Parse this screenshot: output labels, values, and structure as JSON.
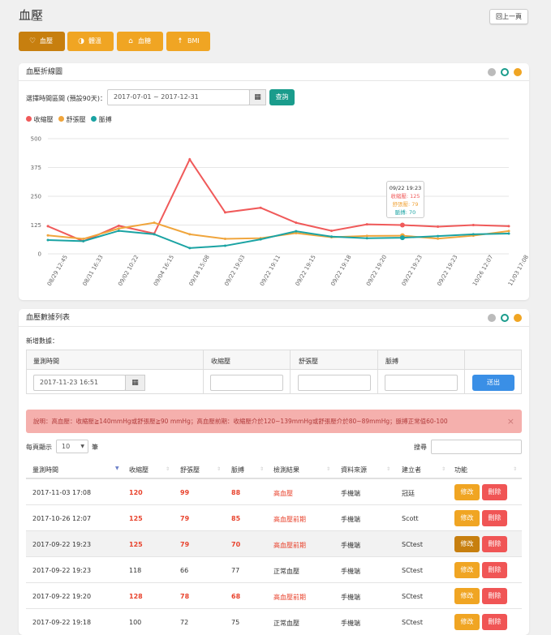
{
  "page": {
    "title": "血壓",
    "back_label": "回上一頁"
  },
  "tabs": [
    {
      "label": "血壓",
      "icon": "heart-icon"
    },
    {
      "label": "體溫",
      "icon": "thermometer-icon"
    },
    {
      "label": "血糖",
      "icon": "drop-icon"
    },
    {
      "label": "BMI",
      "icon": "person-icon"
    }
  ],
  "colors": {
    "accent": "#f0a523",
    "accent_active": "#c77f0f",
    "systolic": "#f05a5a",
    "diastolic": "#f0a53c",
    "pulse": "#1aa3a3",
    "query": "#1a9c8c",
    "submit": "#3a8fe6",
    "alert_bg": "#f5b0ad"
  },
  "chart_panel": {
    "title": "血壓折線圖",
    "range_label": "選擇時間區間 (預設90天)：",
    "range_value": "2017-07-01 ~ 2017-12-31",
    "query_label": "查詢",
    "legend": [
      "收縮壓",
      "舒張壓",
      "脈搏"
    ],
    "tooltip": {
      "time": "09/22 19:23",
      "systolic": "收縮壓: 125",
      "diastolic": "舒張壓: 79",
      "pulse": "脈搏: 70"
    }
  },
  "chart_data": {
    "type": "line",
    "x": [
      "08/29 12:45",
      "08/31 16:33",
      "09/02 10:22",
      "09/04 16:15",
      "09/18 15:08",
      "09/22 19:03",
      "09/22 19:11",
      "09/22 19:15",
      "09/22 19:18",
      "09/22 19:20",
      "09/22 19:23",
      "10/26 12:07",
      "11/03 17:08"
    ],
    "x_ticks": [
      "08/29 12:45",
      "08/31 16:33",
      "09/02 10:22",
      "09/04 16:15",
      "09/18 15:08",
      "09/22 19:03",
      "09/22 19:11",
      "09/22 19:15",
      "09/22 19:18",
      "09/22 19:20",
      "09/22 19:23",
      "09/22 19:23",
      "10/26 12:07",
      "11/03 17:08"
    ],
    "series": [
      {
        "name": "收縮壓",
        "values": [
          120,
          55,
          122,
          88,
          410,
          180,
          200,
          135,
          100,
          128,
          125,
          118,
          125,
          120
        ]
      },
      {
        "name": "舒張壓",
        "values": [
          80,
          65,
          110,
          135,
          85,
          65,
          68,
          90,
          72,
          78,
          79,
          66,
          79,
          99
        ]
      },
      {
        "name": "脈搏",
        "values": [
          60,
          55,
          100,
          85,
          25,
          35,
          63,
          98,
          75,
          68,
          70,
          77,
          85,
          88
        ]
      }
    ],
    "ylim": [
      0,
      500
    ],
    "yticks": [
      0,
      125,
      250,
      375,
      500
    ],
    "grid": true,
    "legend_position": "top-left"
  },
  "table_panel": {
    "title": "血壓數據列表",
    "new_data_label": "新增數據：",
    "form_headers": [
      "量測時間",
      "收縮壓",
      "舒張壓",
      "脈搏",
      ""
    ],
    "form_time_value": "2017-11-23 16:51",
    "submit_label": "送出",
    "alert_text": "說明：高血壓：收縮壓≧140mmHg或舒張壓≧90 mmHg；高血壓前期：收縮壓介於120~139mmHg或舒張壓介於80~89mmHg；脈搏正常值60-100",
    "alert_close": "×",
    "per_page_prefix": "每頁顯示",
    "per_page_value": "10",
    "per_page_suffix": "筆",
    "search_label": "搜尋",
    "columns": [
      "量測時間",
      "收縮壓",
      "舒張壓",
      "脈搏",
      "檢測結果",
      "資料來源",
      "建立者",
      "功能"
    ],
    "edit_label": "修改",
    "delete_label": "刪除",
    "rows": [
      {
        "time": "2017-11-03 17:08",
        "sys": "120",
        "dia": "99",
        "pulse": "88",
        "result": "高血壓",
        "source": "手機端",
        "creator": "冠廷",
        "hl": [
          true,
          true,
          true,
          true
        ]
      },
      {
        "time": "2017-10-26 12:07",
        "sys": "125",
        "dia": "79",
        "pulse": "85",
        "result": "高血壓前期",
        "source": "手機端",
        "creator": "Scott",
        "hl": [
          true,
          true,
          true,
          true
        ]
      },
      {
        "time": "2017-09-22 19:23",
        "sys": "125",
        "dia": "79",
        "pulse": "70",
        "result": "高血壓前期",
        "source": "手機端",
        "creator": "SCtest",
        "hl": [
          true,
          true,
          true,
          true
        ]
      },
      {
        "time": "2017-09-22 19:23",
        "sys": "118",
        "dia": "66",
        "pulse": "77",
        "result": "正常血壓",
        "source": "手機端",
        "creator": "SCtest",
        "hl": [
          false,
          false,
          false,
          false
        ]
      },
      {
        "time": "2017-09-22 19:20",
        "sys": "128",
        "dia": "78",
        "pulse": "68",
        "result": "高血壓前期",
        "source": "手機端",
        "creator": "SCtest",
        "hl": [
          true,
          true,
          true,
          true
        ]
      },
      {
        "time": "2017-09-22 19:18",
        "sys": "100",
        "dia": "72",
        "pulse": "75",
        "result": "正常血壓",
        "source": "手機端",
        "creator": "SCtest",
        "hl": [
          false,
          false,
          false,
          false
        ]
      }
    ]
  }
}
